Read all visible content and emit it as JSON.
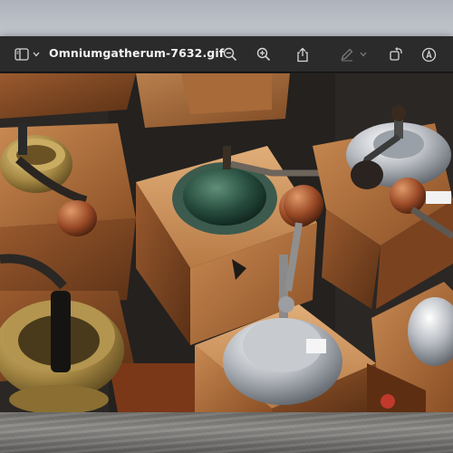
{
  "window": {
    "title": "Omniumgatherum-7632.gif",
    "toolbar": {
      "sidebar_toggle_icon": "sidebar-icon",
      "zoom_out_icon": "magnifier-minus-icon",
      "zoom_in_icon": "magnifier-plus-icon",
      "share_icon": "share-icon",
      "markup_icon": "pencil-icon",
      "rotate_icon": "rotate-icon",
      "annotate_icon": "markup-circle-icon"
    }
  },
  "image": {
    "subject": "antique coffee grinders"
  },
  "colors": {
    "toolbar_bg": "#2b2b2b",
    "toolbar_icon": "#d6d6d6",
    "title_text": "#f2f2f2"
  }
}
